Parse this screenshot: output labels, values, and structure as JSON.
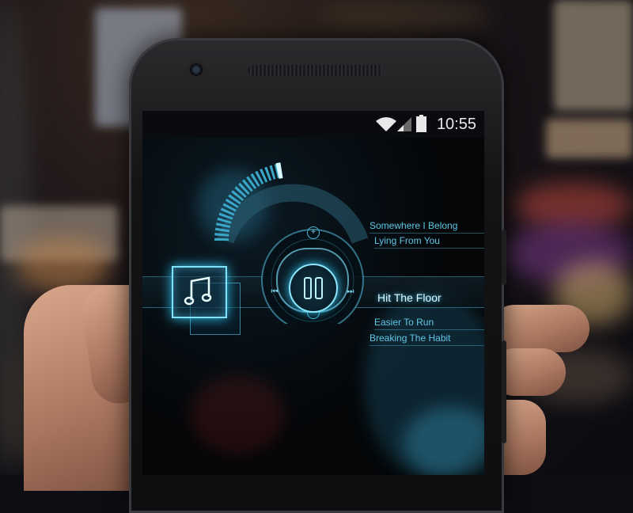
{
  "status_bar": {
    "time": "10:55",
    "icons": [
      "wifi-icon",
      "signal-icon",
      "battery-icon"
    ]
  },
  "player": {
    "now_playing_icon": "music-note-icon",
    "play_state": "paused",
    "volume_level": 0.45,
    "controls": {
      "volume_up": "+",
      "volume_down": "−",
      "previous": "⏮",
      "next": "⏭",
      "pause": "pause-icon"
    }
  },
  "playlist": {
    "tracks": [
      {
        "title": "Somewhere I Belong",
        "current": false
      },
      {
        "title": "Lying From You",
        "current": false
      },
      {
        "title": "Hit The Floor",
        "current": true
      },
      {
        "title": "Easier To Run",
        "current": false
      },
      {
        "title": "Breaking The Habit",
        "current": false
      }
    ]
  },
  "colors": {
    "accent": "#3ed0ff",
    "accent_dim": "#5fc7e6",
    "screen_bg": "#030509"
  }
}
